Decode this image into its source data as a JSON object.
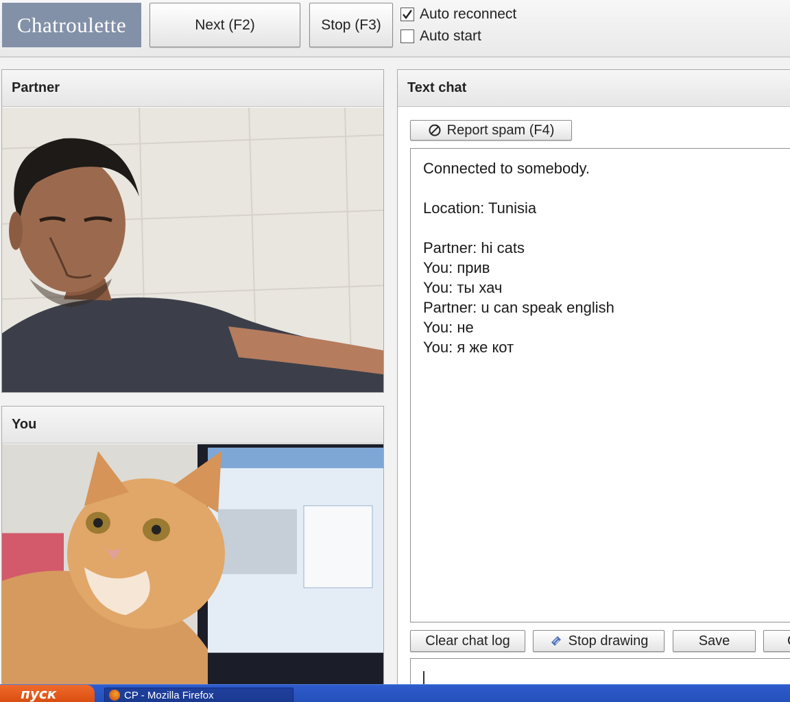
{
  "toolbar": {
    "logo": "Chatroulette",
    "next_label": "Next (F2)",
    "stop_label": "Stop (F3)",
    "auto_reconnect": {
      "label": "Auto reconnect",
      "checked": true
    },
    "auto_start": {
      "label": "Auto start",
      "checked": false
    }
  },
  "partner_panel": {
    "title": "Partner"
  },
  "you_panel": {
    "title": "You"
  },
  "chat": {
    "title": "Text chat",
    "report_label": "Report spam (F4)",
    "log": [
      "Connected to somebody.",
      "",
      "Location: Tunisia",
      "",
      "Partner: hi cats",
      "You: прив",
      "You: ты хач",
      "Partner: u can speak english",
      "You: не",
      "You: я же кот"
    ],
    "buttons": {
      "clear": "Clear chat log",
      "stop_drawing": "Stop drawing",
      "save": "Save",
      "more": "C"
    },
    "input_value": ""
  },
  "taskbar": {
    "start": "пуск",
    "window": "CP - Mozilla Firefox"
  }
}
